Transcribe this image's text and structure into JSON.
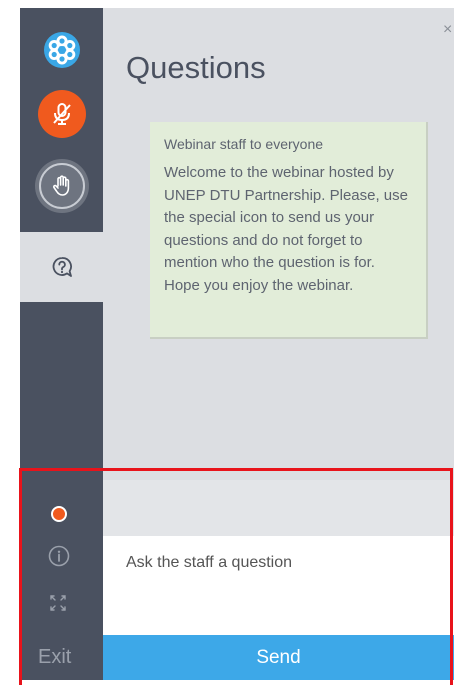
{
  "sidebar": {
    "icons": [
      "app-logo-icon",
      "microphone-muted-icon",
      "raise-hand-icon",
      "question-icon",
      "status-dot",
      "info-icon",
      "fullscreen-icon"
    ],
    "exit_label": "Exit"
  },
  "questions": {
    "title": "Questions",
    "close_label": "×",
    "message": {
      "sender": "Webinar staff to everyone",
      "body": "Welcome to the webinar hosted by UNEP DTU Partnership. Please, use the special icon to send us your questions and do not forget to mention who the question is for. Hope you enjoy the webinar."
    },
    "input_placeholder": "Ask the staff a question",
    "send_label": "Send"
  },
  "colors": {
    "sidebar": "#4a5160",
    "accent_orange": "#f05a1e",
    "send_blue": "#3da8e8",
    "message_bg": "#e2edd9",
    "highlight_red": "#e8131b"
  }
}
